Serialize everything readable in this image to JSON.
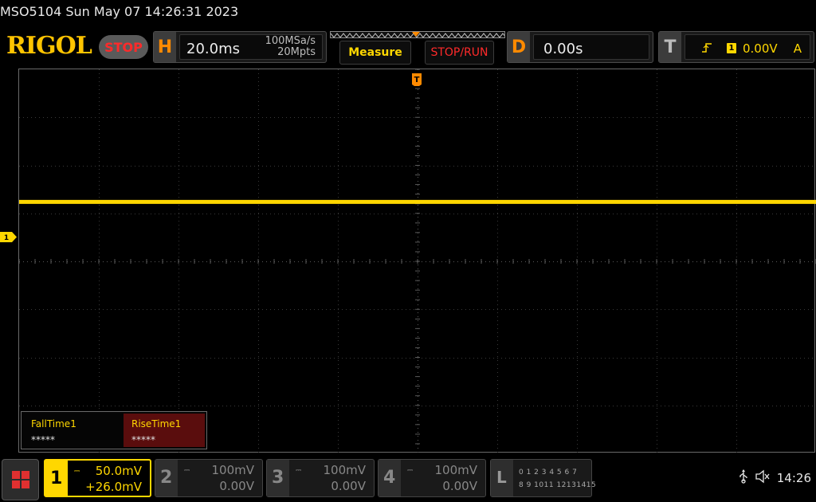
{
  "header": {
    "title": "MSO5104  Sun May 07 14:26:31 2023",
    "logo": "RIGOL",
    "run_state": "STOP"
  },
  "horizontal": {
    "tag": "H",
    "timebase": "20.0ms",
    "sample_rate": "100MSa/s",
    "memory_depth": "20Mpts"
  },
  "buttons": {
    "measure": "Measure",
    "stop_run": "STOP/RUN"
  },
  "delay": {
    "tag": "D",
    "value": "0.00s"
  },
  "trigger": {
    "tag": "T",
    "source": "1",
    "level": "0.00V",
    "mode": "A"
  },
  "markers": {
    "trigger_pos": "T",
    "ch1_offset": "1"
  },
  "measurements": [
    {
      "label": "FallTime1",
      "value": "*****"
    },
    {
      "label": "RiseTime1",
      "value": "*****"
    }
  ],
  "channels": [
    {
      "num": "1",
      "scale": "50.0mV",
      "offset": "+26.0mV",
      "active": true
    },
    {
      "num": "2",
      "scale": "100mV",
      "offset": "0.00V",
      "active": false
    },
    {
      "num": "3",
      "scale": "100mV",
      "offset": "0.00V",
      "active": false
    },
    {
      "num": "4",
      "scale": "100mV",
      "offset": "0.00V",
      "active": false
    }
  ],
  "logic": {
    "tag": "L",
    "row1": "0 1 2 3   4 5 6 7",
    "row2": "8 9 1011 12131415"
  },
  "status_bar": {
    "time": "14:26"
  },
  "colors": {
    "ch1": "#ffd700",
    "accent": "#ff8a00",
    "stop": "#ff2a2a"
  }
}
